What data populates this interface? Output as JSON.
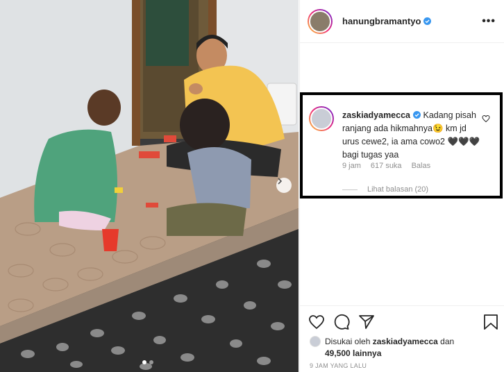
{
  "post_header": {
    "username": "hanungbramantyo",
    "more_label": "•••"
  },
  "comment": {
    "username": "zaskiadyamecca",
    "text": "Kadang pisah ranjang ada hikmahnya😉 km jd urus cewe2, ia ama cowo2 🖤🖤🖤 bagi tugas yaa",
    "time": "9 jam",
    "likes": "617 suka",
    "reply_label": "Balas",
    "view_replies": "Lihat balasan (20)"
  },
  "actions": {
    "liked_prefix": "Disukai oleh",
    "liked_user": "zaskiadyamecca",
    "liked_and": "dan",
    "liked_others": "49,500 lainnya",
    "timestamp": "9 JAM YANG LALU"
  },
  "carousel": {
    "slide_count": 2,
    "active_slide": 1
  },
  "colors": {
    "verified": "#3897f0",
    "text": "#262626",
    "muted": "#8e8e8e"
  },
  "icons": [
    "heart-icon",
    "comment-icon",
    "share-icon",
    "bookmark-icon",
    "verified-icon",
    "chevron-right-icon"
  ]
}
